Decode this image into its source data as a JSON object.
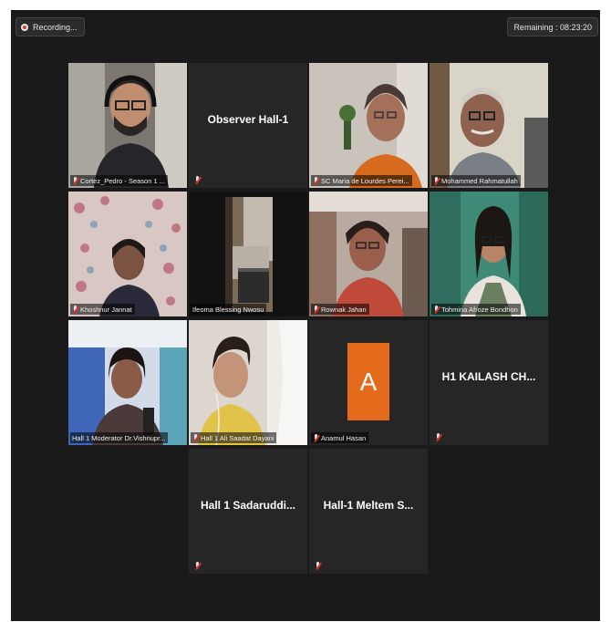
{
  "meeting": {
    "recording_label": "Recording...",
    "remaining_label": "Remaining : 08:23:20"
  },
  "tiles": [
    {
      "name": "Cortez_Pedro - Season 1 ...",
      "video": true,
      "muted": true
    },
    {
      "name": "Observer Hall-1",
      "video": false,
      "muted": true
    },
    {
      "name": "SC Maria de Lourdes Perei...",
      "video": true,
      "muted": true
    },
    {
      "name": "Mohammed Rahmatullah",
      "video": true,
      "muted": true
    },
    {
      "name": "Khoshnur Jannat",
      "video": true,
      "muted": true
    },
    {
      "name": "Ifeoma Blessing Nwosu",
      "video": true,
      "muted": false,
      "active_speaker": true
    },
    {
      "name": "Rownak Jahan",
      "video": true,
      "muted": true
    },
    {
      "name": "Tohmina Afroze Bondhon",
      "video": true,
      "muted": true
    },
    {
      "name": "Hall 1 Moderator Dr.Vishnupr...",
      "video": true,
      "muted": false
    },
    {
      "name": "Hall 1 Ali Saadat Dayani",
      "video": true,
      "muted": true
    },
    {
      "name": "Anamul Hasan",
      "video": false,
      "muted": true,
      "avatar_letter": "A"
    },
    {
      "name": "H1 KAILASH CH...",
      "video": false,
      "muted": true
    },
    {
      "name": "Hall 1 Sadaruddi...",
      "video": false,
      "muted": true
    },
    {
      "name": "Hall-1 Meltem S...",
      "video": false,
      "muted": true
    }
  ]
}
